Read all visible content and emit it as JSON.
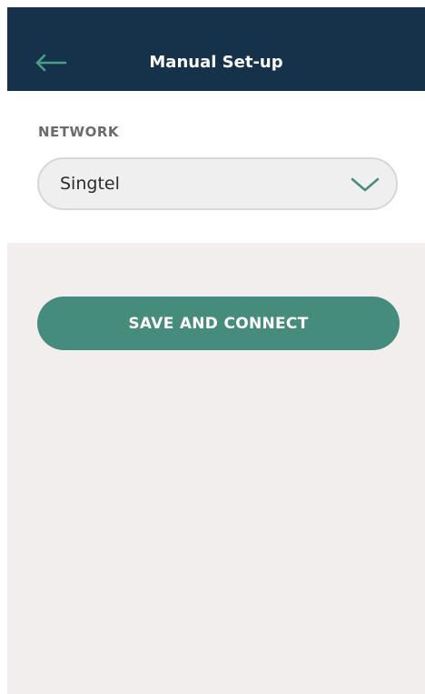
{
  "header": {
    "title": "Manual Set-up",
    "back_icon": "arrow-left-icon"
  },
  "network": {
    "label": "NETWORK",
    "selected": "Singtel",
    "dropdown_icon": "chevron-down-icon"
  },
  "actions": {
    "save_label": "SAVE AND CONNECT"
  },
  "colors": {
    "header_bg": "#16324b",
    "accent": "#458c7c",
    "page_bg": "#f2eeed"
  }
}
